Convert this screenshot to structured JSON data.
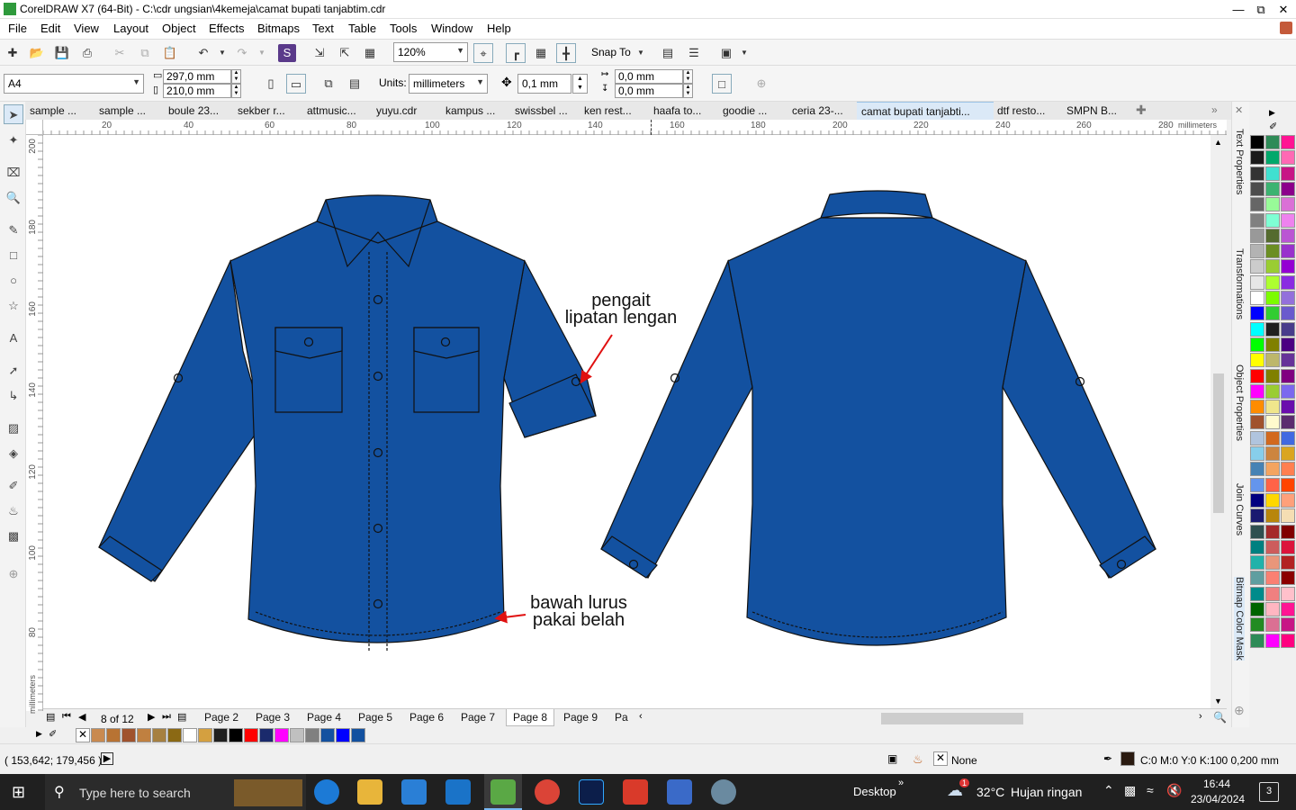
{
  "window": {
    "title": "CorelDRAW X7 (64-Bit) - C:\\cdr ungsian\\4kemeja\\camat bupati tanjabtim.cdr"
  },
  "menu": [
    "File",
    "Edit",
    "View",
    "Layout",
    "Object",
    "Effects",
    "Bitmaps",
    "Text",
    "Table",
    "Tools",
    "Window",
    "Help"
  ],
  "standard_toolbar": {
    "zoom": "120%",
    "snap_label": "Snap To"
  },
  "property_bar": {
    "page_size": "A4",
    "width": "297,0 mm",
    "height": "210,0 mm",
    "units_label": "Units:",
    "units": "millimeters",
    "nudge": "0,1 mm",
    "dup_x": "0,0 mm",
    "dup_y": "0,0 mm"
  },
  "doc_tabs": [
    "sample ...",
    "sample ...",
    "boule 23...",
    "sekber r...",
    "attmusic...",
    "yuyu.cdr",
    "kampus ...",
    "swissbel ...",
    "ken rest...",
    "haafa to...",
    "goodie ...",
    "ceria 23-...",
    "camat bupati tanjabti...",
    "dtf resto...",
    "SMPN B..."
  ],
  "active_doc_tab": 12,
  "ruler": {
    "h_ticks": [
      "20",
      "40",
      "60",
      "80",
      "100",
      "120",
      "140",
      "160",
      "180",
      "200",
      "220",
      "240",
      "260",
      "280"
    ],
    "h_unit": "millimeters",
    "v_ticks": [
      "200",
      "180",
      "160",
      "140",
      "120",
      "100",
      "80"
    ],
    "v_unit": "millimeters"
  },
  "canvas": {
    "label1_line1": "pengait",
    "label1_line2": "lipatan lengan",
    "label2_line1": "bawah lurus",
    "label2_line2": "pakai belah",
    "shirt_color": "#1351a0"
  },
  "page_nav": {
    "counter": "8 of 12",
    "tabs": [
      "Page 2",
      "Page 3",
      "Page 4",
      "Page 5",
      "Page 6",
      "Page 7",
      "Page 8",
      "Page 9",
      "Pa"
    ],
    "active": "Page 8"
  },
  "dockers": [
    "Text Properties",
    "Transformations",
    "Object Properties",
    "Join Curves",
    "Bitmap Color Mask"
  ],
  "status": {
    "coords": "( 153,642; 179,456 )",
    "fill_label": "None",
    "outline": "C:0 M:0 Y:0 K:100  0,200 mm"
  },
  "taskbar": {
    "search": "Type here to search",
    "desktop": "Desktop",
    "weather_temp": "32°C",
    "weather_desc": "Hujan ringan",
    "time": "16:44",
    "date": "23/04/2024",
    "notif_count": "3",
    "weather_badge": "1"
  },
  "doc_palette_colors": [
    "#c98a50",
    "#b87333",
    "#a0522d",
    "#c08040",
    "#a68040",
    "#8b6914",
    "#ffffff",
    "#d4a040",
    "#1f1f1f",
    "#000000",
    "#ff0000",
    "#1a2a6c",
    "#ff00ff",
    "#c0c0c0",
    "#808080",
    "#1351a0",
    "#0000ff",
    "#1351a0"
  ],
  "palette_colors": [
    [
      "#000000",
      "#2e8b57",
      "#ff1493"
    ],
    [
      "#1a1a1a",
      "#00a86b",
      "#ff69b4"
    ],
    [
      "#333333",
      "#40e0d0",
      "#c71585"
    ],
    [
      "#4d4d4d",
      "#3cb371",
      "#8b008b"
    ],
    [
      "#666666",
      "#98fb98",
      "#da70d6"
    ],
    [
      "#808080",
      "#7fffd4",
      "#ee82ee"
    ],
    [
      "#999999",
      "#556b2f",
      "#ba55d3"
    ],
    [
      "#b3b3b3",
      "#6b8e23",
      "#9932cc"
    ],
    [
      "#cccccc",
      "#9acd32",
      "#9400d3"
    ],
    [
      "#e6e6e6",
      "#adff2f",
      "#8a2be2"
    ],
    [
      "#ffffff",
      "#7cfc00",
      "#9370db"
    ],
    [
      "#0000ff",
      "#32cd32",
      "#6a5acd"
    ],
    [
      "#00ffff",
      "#1f1f1f",
      "#483d8b"
    ],
    [
      "#00ff00",
      "#808000",
      "#4b0082"
    ],
    [
      "#ffff00",
      "#bdb76b",
      "#663399"
    ],
    [
      "#ff0000",
      "#808000",
      "#800080"
    ],
    [
      "#ff00ff",
      "#9acd32",
      "#7b68ee"
    ],
    [
      "#ff8c00",
      "#f0e68c",
      "#6a0dad"
    ],
    [
      "#a0522d",
      "#fffacd",
      "#5b2c6f"
    ],
    [
      "#b0c4de",
      "#d2691e",
      "#4169e1"
    ],
    [
      "#87ceeb",
      "#cd853f",
      "#daa520"
    ],
    [
      "#4682b4",
      "#f4a460",
      "#ff7f50"
    ],
    [
      "#6495ed",
      "#ff6347",
      "#ff4500"
    ],
    [
      "#000080",
      "#ffd700",
      "#ffa07a"
    ],
    [
      "#191970",
      "#b8860b",
      "#f5deb3"
    ],
    [
      "#2f4f4f",
      "#a52a2a",
      "#800000"
    ],
    [
      "#008080",
      "#cd5c5c",
      "#dc143c"
    ],
    [
      "#20b2aa",
      "#e9967a",
      "#b22222"
    ],
    [
      "#5f9ea0",
      "#fa8072",
      "#8b0000"
    ],
    [
      "#008b8b",
      "#f08080",
      "#ffc0cb"
    ],
    [
      "#006400",
      "#ffb6c1",
      "#ff1493"
    ],
    [
      "#228b22",
      "#db7093",
      "#c71585"
    ],
    [
      "#2e8b57",
      "#ff00ff",
      "#ff0080"
    ]
  ]
}
